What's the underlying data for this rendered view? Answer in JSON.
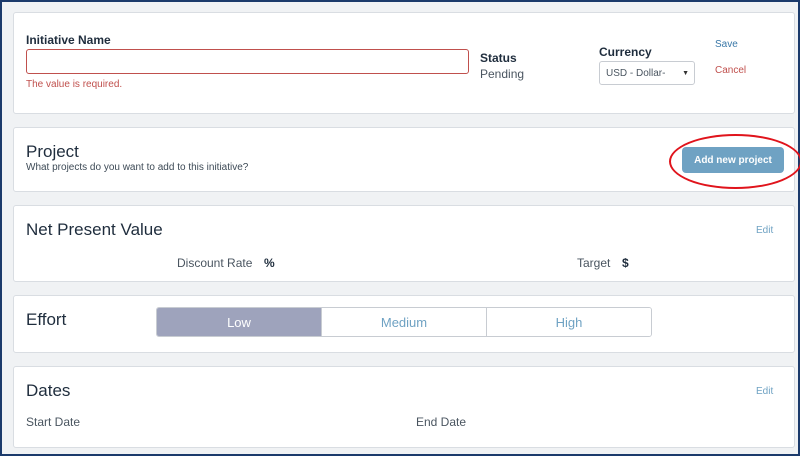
{
  "initiative": {
    "name_label": "Initiative Name",
    "name_value": "",
    "name_placeholder": "",
    "error": "The value is required.",
    "status_label": "Status",
    "status_value": "Pending",
    "currency_label": "Currency",
    "currency_value": "USD - Dollar-",
    "save_label": "Save",
    "cancel_label": "Cancel"
  },
  "project": {
    "title": "Project",
    "subtitle": "What projects do you want to add to this initiative?",
    "add_button": "Add new project"
  },
  "npv": {
    "title": "Net Present Value",
    "edit_label": "Edit",
    "discount_rate_label": "Discount Rate",
    "discount_rate_unit": "%",
    "target_label": "Target",
    "target_unit": "$"
  },
  "effort": {
    "title": "Effort",
    "options": [
      "Low",
      "Medium",
      "High"
    ],
    "selected": "Low"
  },
  "dates": {
    "title": "Dates",
    "edit_label": "Edit",
    "start_label": "Start Date",
    "end_label": "End Date"
  },
  "colors": {
    "accent": "#6fa2c3",
    "error": "#c0504d",
    "highlight": "#e0141c",
    "effort_selected": "#9ea3bc"
  },
  "icons": {
    "currency_dropdown": "chevron-down-icon"
  }
}
